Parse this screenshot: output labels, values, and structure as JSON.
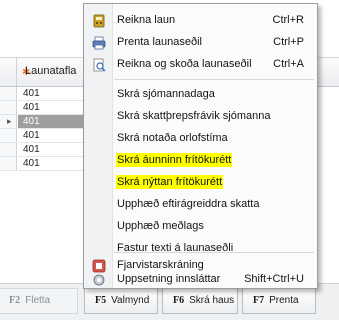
{
  "grid": {
    "column_header": "Launatafla",
    "rows": [
      {
        "value": "401",
        "selected": false
      },
      {
        "value": "401",
        "selected": false
      },
      {
        "value": "401",
        "selected": true
      },
      {
        "value": "401",
        "selected": false
      },
      {
        "value": "401",
        "selected": false
      },
      {
        "value": "401",
        "selected": false
      }
    ]
  },
  "menu": {
    "items": [
      {
        "label": "Reikna laun",
        "shortcut": "Ctrl+R",
        "icon": "calculator-icon",
        "highlighted": false
      },
      {
        "label": "Prenta launaseðil",
        "shortcut": "Ctrl+P",
        "icon": "printer-icon",
        "highlighted": false
      },
      {
        "label": "Reikna og skoða launaseðil",
        "shortcut": "Ctrl+A",
        "icon": "preview-icon",
        "highlighted": false
      },
      {
        "label": "Skrá sjómannadaga",
        "shortcut": "",
        "icon": "",
        "highlighted": false
      },
      {
        "label": "Skrá skattþrepsfrávik sjómanna",
        "shortcut": "",
        "icon": "",
        "highlighted": false
      },
      {
        "label": "Skrá notaða orlofstíma",
        "shortcut": "",
        "icon": "",
        "highlighted": false
      },
      {
        "label": "Skrá áunninn frítökurétt",
        "shortcut": "",
        "icon": "",
        "highlighted": true
      },
      {
        "label": "Skrá nýttan frítökurétt",
        "shortcut": "",
        "icon": "",
        "highlighted": true
      },
      {
        "label": "Upphæð eftirágreiddra skatta",
        "shortcut": "",
        "icon": "",
        "highlighted": false
      },
      {
        "label": "Upphæð meðlags",
        "shortcut": "",
        "icon": "",
        "highlighted": false
      },
      {
        "label": "Fastur texti á launaseðli",
        "shortcut": "",
        "icon": "",
        "highlighted": false
      },
      {
        "label": "Fjarvistarskráning",
        "shortcut": "",
        "icon": "absence-icon",
        "highlighted": false
      },
      {
        "label": "Uppsetning innsláttar",
        "shortcut": "Shift+Ctrl+U",
        "icon": "settings-icon",
        "highlighted": false
      }
    ]
  },
  "footer": {
    "keys": [
      {
        "key": "F2",
        "label": "Fletta",
        "enabled": false
      },
      {
        "key": "F5",
        "label": "Valmynd",
        "enabled": true
      },
      {
        "key": "F6",
        "label": "Skrá haus",
        "enabled": true
      },
      {
        "key": "F7",
        "label": "Prenta",
        "enabled": true
      }
    ]
  },
  "colors": {
    "highlight": "#ffff00",
    "selected_row": "#9e9e9e",
    "header_star": "#e87722"
  }
}
